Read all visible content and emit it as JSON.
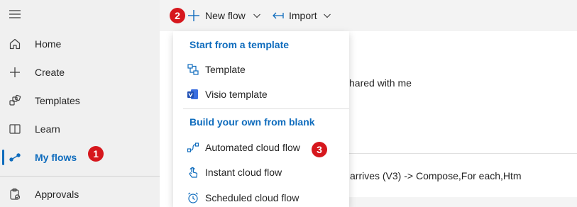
{
  "nav": {
    "items": [
      {
        "label": "Home",
        "icon": "home-icon"
      },
      {
        "label": "Create",
        "icon": "plus-icon"
      },
      {
        "label": "Templates",
        "icon": "templates-icon"
      },
      {
        "label": "Learn",
        "icon": "book-icon"
      },
      {
        "label": "My flows",
        "icon": "flow-icon",
        "active": true
      },
      {
        "label": "Approvals",
        "icon": "approvals-icon"
      }
    ]
  },
  "toolbar": {
    "new_flow_label": "New flow",
    "import_label": "Import"
  },
  "badges": {
    "one": "1",
    "two": "2",
    "three": "3",
    "color": "#d6171d"
  },
  "dropdown": {
    "section_template": "Start from a template",
    "template_label": "Template",
    "visio_label": "Visio template",
    "section_blank": "Build your own from blank",
    "automated_label": "Automated cloud flow",
    "instant_label": "Instant cloud flow",
    "scheduled_label": "Scheduled cloud flow"
  },
  "background": {
    "shared_text": "hared with me",
    "flow_row_text": "arrives (V3) -> Compose,For each,Htm"
  },
  "colors": {
    "accent": "#0f6cbd",
    "nav_bg": "#f0f0f0",
    "cmdbar_bg": "#f3f3f3"
  }
}
